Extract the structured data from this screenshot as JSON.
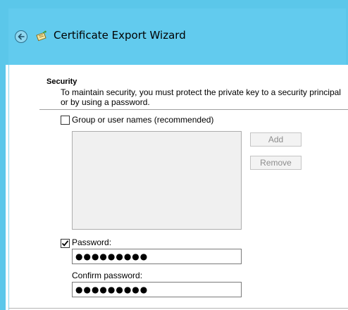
{
  "window": {
    "title": "Certificate Export Wizard"
  },
  "section": {
    "heading": "Security",
    "description": "To maintain security, you must protect the private key to a security principal or by using a password."
  },
  "group_option": {
    "label": "Group or user names (recommended)",
    "checked": false
  },
  "buttons": {
    "add": "Add",
    "remove": "Remove"
  },
  "password_option": {
    "label": "Password:",
    "checked": true,
    "value": "●●●●●●●●●"
  },
  "confirm_password": {
    "label": "Confirm password:",
    "value": "●●●●●●●●●"
  },
  "colors": {
    "titlebar": "#5bc7ea",
    "disabled_text": "#8d8d8d"
  },
  "icons": {
    "back": "back-arrow-icon",
    "wizard": "certificate-wizard-icon",
    "check": "checkmark-icon"
  }
}
